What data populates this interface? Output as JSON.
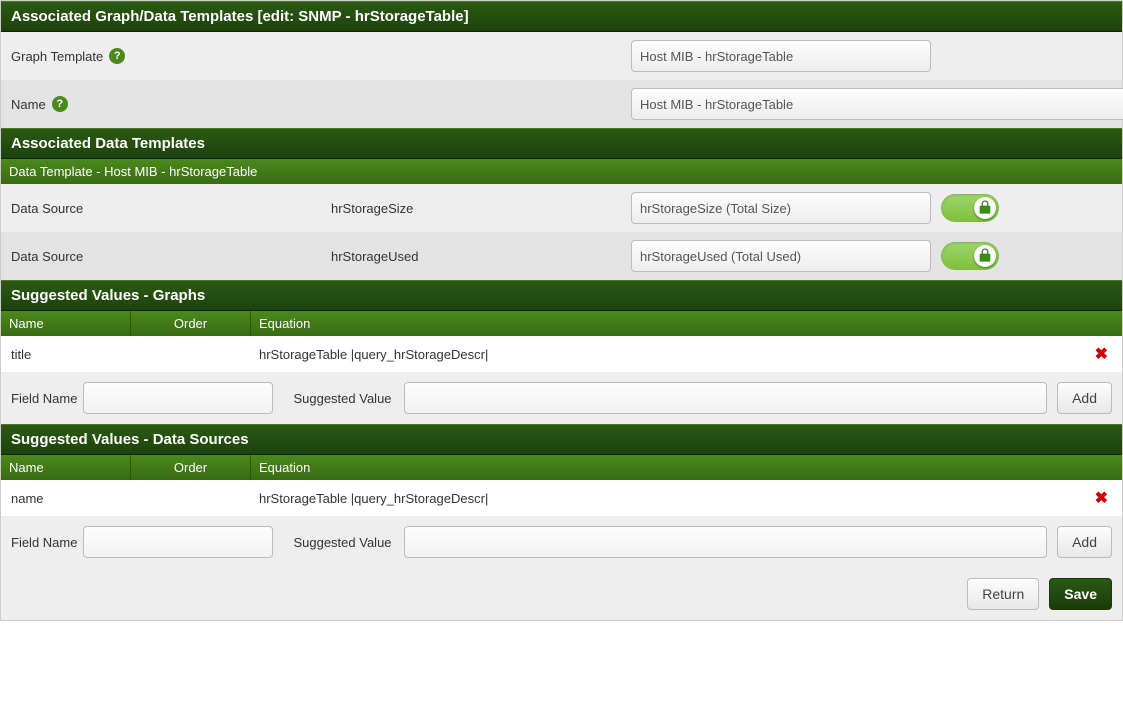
{
  "header": {
    "title": "Associated Graph/Data Templates [edit: SNMP - hrStorageTable]"
  },
  "graphTemplate": {
    "label": "Graph Template",
    "selected": "Host MIB - hrStorageTable"
  },
  "name": {
    "label": "Name",
    "value": "Host MIB - hrStorageTable"
  },
  "dataTemplates": {
    "heading": "Associated Data Templates",
    "sub": "Data Template - Host MIB - hrStorageTable",
    "rows": [
      {
        "label": "Data Source",
        "ds": "hrStorageSize",
        "selected": "hrStorageSize (Total Size)"
      },
      {
        "label": "Data Source",
        "ds": "hrStorageUsed",
        "selected": "hrStorageUsed (Total Used)"
      }
    ]
  },
  "suggestedGraphs": {
    "heading": "Suggested Values - Graphs",
    "cols": {
      "name": "Name",
      "order": "Order",
      "eq": "Equation"
    },
    "rows": [
      {
        "name": "title",
        "order": "",
        "eq": "hrStorageTable |query_hrStorageDescr|"
      }
    ],
    "fieldNameLabel": "Field Name",
    "suggestedValueLabel": "Suggested Value",
    "addLabel": "Add"
  },
  "suggestedDS": {
    "heading": "Suggested Values - Data Sources",
    "cols": {
      "name": "Name",
      "order": "Order",
      "eq": "Equation"
    },
    "rows": [
      {
        "name": "name",
        "order": "",
        "eq": "hrStorageTable |query_hrStorageDescr|"
      }
    ],
    "fieldNameLabel": "Field Name",
    "suggestedValueLabel": "Suggested Value",
    "addLabel": "Add"
  },
  "footer": {
    "return": "Return",
    "save": "Save"
  }
}
